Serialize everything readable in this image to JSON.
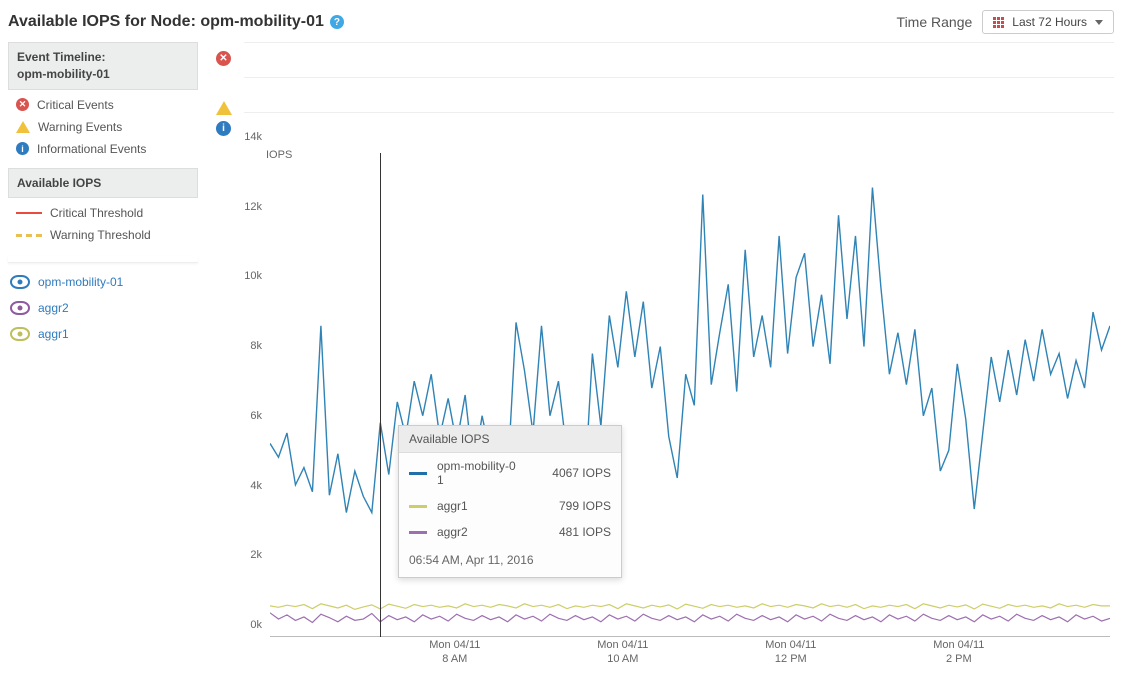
{
  "title": "Available IOPS for Node: opm-mobility-01",
  "time_range": {
    "label": "Time Range",
    "button": "Last 72 Hours"
  },
  "sidebar": {
    "timeline_hd1": "Event Timeline:",
    "timeline_hd2": "opm-mobility-01",
    "events": [
      {
        "label": "Critical Events"
      },
      {
        "label": "Warning Events"
      },
      {
        "label": "Informational Events"
      }
    ],
    "iops_hd": "Available IOPS",
    "thresholds": [
      {
        "label": "Critical Threshold"
      },
      {
        "label": "Warning Threshold"
      }
    ],
    "series_links": [
      {
        "label": "opm-mobility-01",
        "color": "blue"
      },
      {
        "label": "aggr2",
        "color": "purple"
      },
      {
        "label": "aggr1",
        "color": "olive"
      }
    ]
  },
  "tooltip": {
    "title": "Available IOPS",
    "rows": [
      {
        "name": "opm-mobility-01",
        "name_wrapped": "opm-mobility-0\n1",
        "value": "4067 IOPS",
        "sw": "blue"
      },
      {
        "name": "aggr1",
        "value": "799 IOPS",
        "sw": "olive"
      },
      {
        "name": "aggr2",
        "value": "481 IOPS",
        "sw": "purple"
      }
    ],
    "timestamp": "06:54 AM, Apr 11, 2016"
  },
  "chart_data": {
    "type": "line",
    "title": "Available IOPS for Node: opm-mobility-01",
    "xlabel": "",
    "ylabel": "IOPS",
    "ylim": [
      0,
      14000
    ],
    "y_ticks": [
      "0k",
      "2k",
      "4k",
      "6k",
      "8k",
      "10k",
      "12k",
      "14k"
    ],
    "x_ticks": [
      {
        "pos": 0.22,
        "l1": "Mon 04/11",
        "l2": "8 AM"
      },
      {
        "pos": 0.42,
        "l1": "Mon 04/11",
        "l2": "10 AM"
      },
      {
        "pos": 0.62,
        "l1": "Mon 04/11",
        "l2": "12 PM"
      },
      {
        "pos": 0.82,
        "l1": "Mon 04/11",
        "l2": "2 PM"
      }
    ],
    "cursor_x": 0.131,
    "series": [
      {
        "name": "opm-mobility-01",
        "color": "#2f83b5",
        "values": [
          5600,
          5200,
          5900,
          4400,
          4900,
          4200,
          9000,
          4100,
          5300,
          3600,
          4800,
          4067,
          3600,
          6200,
          4700,
          6800,
          5800,
          7400,
          6400,
          7600,
          5800,
          6900,
          5600,
          7000,
          4800,
          6400,
          5200,
          6000,
          4600,
          9100,
          7700,
          5900,
          9000,
          6400,
          7400,
          5300,
          5900,
          3900,
          8200,
          6100,
          9300,
          7800,
          10000,
          8100,
          9700,
          7200,
          8400,
          5800,
          4600,
          7600,
          6700,
          12800,
          7300,
          8800,
          10200,
          7100,
          11200,
          8100,
          9300,
          7800,
          11600,
          8200,
          10400,
          11100,
          8400,
          9900,
          7900,
          12200,
          9200,
          11600,
          8400,
          13000,
          10100,
          7600,
          8800,
          7300,
          8900,
          6400,
          7200,
          4800,
          5400,
          7900,
          6300,
          3700,
          5900,
          8100,
          6800,
          8300,
          7000,
          8600,
          7400,
          8900,
          7600,
          8200,
          6900,
          8000,
          7200,
          9400,
          8300,
          9000
        ]
      },
      {
        "name": "aggr1",
        "color": "#cdce6a",
        "values": [
          900,
          860,
          920,
          880,
          940,
          820,
          960,
          900,
          840,
          920,
          799,
          870,
          930,
          810,
          950,
          890,
          830,
          940,
          880,
          920,
          860,
          900,
          840,
          960,
          880,
          920,
          860,
          940,
          900,
          840,
          960,
          880,
          920,
          860,
          940,
          820,
          900,
          860,
          920,
          880,
          940,
          820,
          960,
          900,
          840,
          920,
          870,
          930,
          810,
          950,
          890,
          830,
          940,
          880,
          920,
          860,
          900,
          840,
          960,
          880,
          920,
          860,
          940,
          900,
          840,
          960,
          880,
          920,
          860,
          940,
          820,
          900,
          860,
          920,
          880,
          940,
          820,
          960,
          900,
          840,
          920,
          870,
          930,
          810,
          950,
          890,
          830,
          940,
          880,
          920,
          860,
          900,
          840,
          960,
          880,
          920,
          860,
          940,
          900,
          900
        ]
      },
      {
        "name": "aggr2",
        "color": "#9d6fb0",
        "values": [
          700,
          520,
          640,
          480,
          580,
          420,
          660,
          560,
          440,
          600,
          481,
          520,
          680,
          440,
          620,
          500,
          580,
          440,
          640,
          520,
          600,
          460,
          660,
          540,
          480,
          620,
          500,
          580,
          440,
          640,
          520,
          600,
          460,
          660,
          540,
          480,
          620,
          500,
          580,
          440,
          640,
          520,
          600,
          460,
          660,
          540,
          480,
          620,
          500,
          580,
          440,
          640,
          520,
          600,
          460,
          660,
          540,
          480,
          620,
          500,
          580,
          440,
          640,
          520,
          600,
          460,
          660,
          540,
          480,
          620,
          500,
          580,
          440,
          640,
          520,
          600,
          460,
          660,
          540,
          480,
          620,
          500,
          580,
          440,
          640,
          520,
          600,
          460,
          660,
          540,
          480,
          620,
          500,
          580,
          440,
          640,
          520,
          600,
          460,
          540
        ]
      }
    ]
  }
}
